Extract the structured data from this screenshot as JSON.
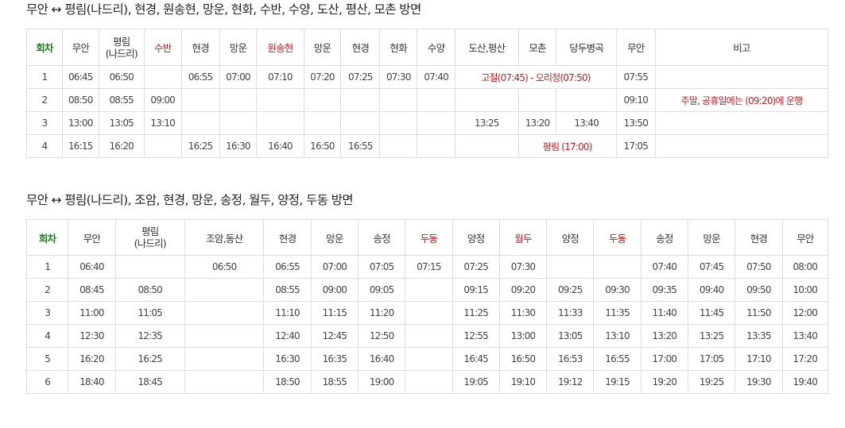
{
  "section1": {
    "title": "무안 ↔ 평림(나드리), 현경, 원송현, 망운, 현화, 수반, 수양, 도산, 평산, 모촌 방면",
    "headers": [
      "회차",
      "무안",
      "평림\n(나드리)",
      "수반",
      "현경",
      "망운",
      "원송현",
      "망운",
      "현경",
      "현화",
      "수양",
      "도산,평산",
      "모촌",
      "당두병곡",
      "무안",
      "비고"
    ],
    "rows": [
      {
        "round": "1",
        "muan": "06:45",
        "pyeongrim": "06:50",
        "suban": "",
        "hyeongyeong1": "06:55",
        "mangun1": "07:00",
        "wonsonghyeon": "07:10",
        "mangun2": "07:20",
        "hyeongyeong2": "07:25",
        "hyeonhwa": "07:30",
        "suyang": "07:40",
        "note_route": "고절(07:45) - 오리정(07:50)",
        "muan_end": "07:55",
        "remark": ""
      },
      {
        "round": "2",
        "muan": "08:50",
        "pyeongrim": "08:55",
        "suban": "09:00",
        "hyeongyeong1": "",
        "mangun1": "",
        "wonsonghyeon": "",
        "mangun2": "",
        "hyeongyeong2": "",
        "hyeonhwa": "",
        "suyang": "",
        "dosan": "",
        "mochon": "",
        "dangdu": "",
        "muan_end": "09:10",
        "remark": "주말, 공휴일에는 (09:20)에 운행"
      },
      {
        "round": "3",
        "muan": "13:00",
        "pyeongrim": "13:05",
        "suban": "13:10",
        "hyeongyeong1": "",
        "mangun1": "",
        "wonsonghyeon": "",
        "mangun2": "",
        "hyeongyeong2": "",
        "hyeonhwa": "",
        "suyang": "",
        "dosan": "13:25",
        "mochon": "13:20",
        "dangdu": "13:40",
        "muan_end": "13:50",
        "remark": ""
      },
      {
        "round": "4",
        "muan": "16:15",
        "pyeongrim": "16:20",
        "suban": "",
        "hyeongyeong1": "16:25",
        "mangun1": "16:30",
        "wonsonghyeon": "16:40",
        "mangun2": "16:50",
        "hyeongyeong2": "16:55",
        "hyeonhwa": "",
        "suyang": "",
        "dosan": "",
        "note_route": "평림 (17:00)",
        "muan_end": "17:05",
        "remark": ""
      }
    ]
  },
  "section2": {
    "title": "무안 ↔ 평림(나드리), 조암, 현경, 망운, 송정, 월두, 양정, 두동 방면",
    "headers": [
      "회차",
      "무안",
      "평림\n(나드리)",
      "조암,동산",
      "현경",
      "망운",
      "송정",
      "두동",
      "양정",
      "월두",
      "양정",
      "두동",
      "송정",
      "망운",
      "현경",
      "무안"
    ],
    "rows": [
      [
        "1",
        "06:40",
        "",
        "06:50",
        "06:55",
        "07:00",
        "07:05",
        "07:15",
        "07:25",
        "07:30",
        "",
        "",
        "07:40",
        "07:45",
        "07:50",
        "08:00"
      ],
      [
        "2",
        "08:45",
        "08:50",
        "",
        "08:55",
        "09:00",
        "09:05",
        "",
        "09:15",
        "09:20",
        "09:25",
        "09:30",
        "09:35",
        "09:40",
        "09:50",
        "10:00"
      ],
      [
        "3",
        "11:00",
        "11:05",
        "",
        "11:10",
        "11:15",
        "11:20",
        "",
        "11:25",
        "11:30",
        "11:33",
        "11:35",
        "11:40",
        "11:45",
        "11:50",
        "12:00"
      ],
      [
        "4",
        "12:30",
        "12:35",
        "",
        "12:40",
        "12:45",
        "12:50",
        "",
        "12:55",
        "13:00",
        "13:05",
        "13:10",
        "13:20",
        "13:25",
        "13:35",
        "13:40"
      ],
      [
        "5",
        "16:20",
        "16:25",
        "",
        "16:30",
        "16:35",
        "16:40",
        "",
        "16:45",
        "16:50",
        "16:53",
        "16:55",
        "17:00",
        "17:05",
        "17:10",
        "17:20"
      ],
      [
        "6",
        "18:40",
        "18:45",
        "",
        "18:50",
        "18:55",
        "19:00",
        "",
        "19:05",
        "19:10",
        "19:12",
        "19:15",
        "19:20",
        "19:25",
        "19:30",
        "19:40"
      ]
    ]
  },
  "colors": {
    "round_header": "#1e7a1e",
    "highlight_stop": "#b22222",
    "border": "#dddddd",
    "text": "#444444"
  }
}
